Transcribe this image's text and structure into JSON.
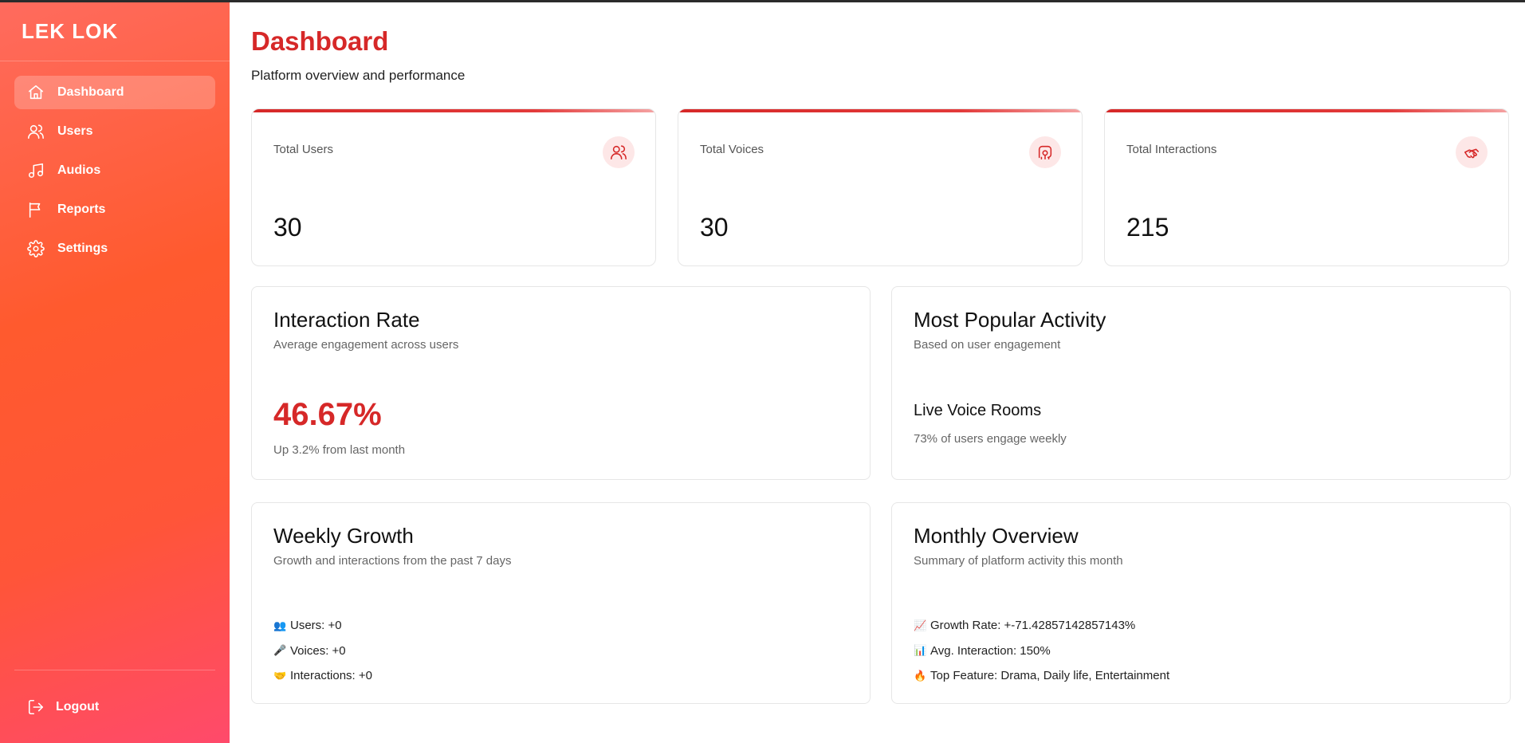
{
  "app": {
    "brand": "LEK LOK"
  },
  "sidebar": {
    "items": [
      {
        "label": "Dashboard",
        "icon": "home-icon",
        "active": true
      },
      {
        "label": "Users",
        "icon": "users-icon"
      },
      {
        "label": "Audios",
        "icon": "music-icon"
      },
      {
        "label": "Reports",
        "icon": "flag-icon"
      },
      {
        "label": "Settings",
        "icon": "gear-icon"
      }
    ],
    "logout_label": "Logout"
  },
  "header": {
    "title": "Dashboard",
    "subtitle": "Platform overview and performance"
  },
  "stats": [
    {
      "label": "Total Users",
      "value": "30",
      "icon": "users-icon"
    },
    {
      "label": "Total Voices",
      "value": "30",
      "icon": "voice-icon"
    },
    {
      "label": "Total Interactions",
      "value": "215",
      "icon": "handshake-icon"
    }
  ],
  "interaction_rate": {
    "title": "Interaction Rate",
    "description": "Average engagement across users",
    "value": "46.67%",
    "note": "Up 3.2% from last month"
  },
  "popular_activity": {
    "title": "Most Popular Activity",
    "description": "Based on user engagement",
    "activity": "Live Voice Rooms",
    "note": "73% of users engage weekly"
  },
  "weekly_growth": {
    "title": "Weekly Growth",
    "description": "Growth and interactions from the past 7 days",
    "items": [
      {
        "emoji": "👥",
        "text": "Users: +0"
      },
      {
        "emoji": "🎤",
        "text": "Voices: +0"
      },
      {
        "emoji": "🤝",
        "text": "Interactions: +0"
      }
    ]
  },
  "monthly_overview": {
    "title": "Monthly Overview",
    "description": "Summary of platform activity this month",
    "items": [
      {
        "emoji": "📈",
        "text": "Growth Rate: +-71.42857142857143%"
      },
      {
        "emoji": "📊",
        "text": "Avg. Interaction: 150%"
      },
      {
        "emoji": "🔥",
        "text": "Top Feature: Drama, Daily life, Entertainment"
      }
    ]
  },
  "colors": {
    "accent": "#d62828",
    "sidebar_start": "#ff6b5e",
    "sidebar_end": "#ff4a6b"
  }
}
